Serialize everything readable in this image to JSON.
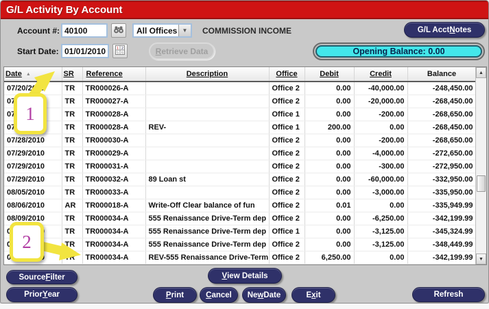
{
  "window": {
    "title": "G/L Activity By Account"
  },
  "toolbar": {
    "account_label": "Account #:",
    "account_value": "40100",
    "office_filter_value": "All Offices",
    "account_name": "COMMISSION INCOME",
    "start_date_label": "Start Date:",
    "start_date_value": "01/01/2010",
    "opening_balance": "Opening Balance: 0.00"
  },
  "buttons": {
    "gl_acct_notes": {
      "pre": "G/L Acct ",
      "mn": "N",
      "post": "otes"
    },
    "retrieve_data": {
      "pre": "",
      "mn": "R",
      "post": "etrieve Data"
    },
    "source_filter": {
      "pre": "Source ",
      "mn": "F",
      "post": "ilter"
    },
    "view_details": {
      "pre": "",
      "mn": "V",
      "post": "iew Details"
    },
    "prior_year": {
      "pre": "Prior ",
      "mn": "Y",
      "post": "ear"
    },
    "print": {
      "pre": "",
      "mn": "P",
      "post": "rint"
    },
    "cancel": {
      "pre": "",
      "mn": "C",
      "post": "ancel"
    },
    "new_date": {
      "pre": "Ne",
      "mn": "w",
      "post": " Date"
    },
    "exit": {
      "pre": "E",
      "mn": "x",
      "post": "it"
    },
    "refresh": {
      "pre": "Refresh",
      "mn": "",
      "post": ""
    }
  },
  "grid": {
    "columns": [
      "Date",
      "SR",
      "Reference",
      "Description",
      "Office",
      "Debit",
      "Credit",
      "Balance"
    ],
    "rows": [
      [
        "07/20/2010",
        "TR",
        "TR000026-A",
        "",
        "Office 2",
        "0.00",
        "-40,000.00",
        "-248,450.00"
      ],
      [
        "07/21/2010",
        "TR",
        "TR000027-A",
        "",
        "Office 2",
        "0.00",
        "-20,000.00",
        "-268,450.00"
      ],
      [
        "07/26/2010",
        "TR",
        "TR000028-A",
        "",
        "Office 1",
        "0.00",
        "-200.00",
        "-268,650.00"
      ],
      [
        "07/26/2010",
        "TR",
        "TR000028-A",
        "REV-",
        "Office 1",
        "200.00",
        "0.00",
        "-268,450.00"
      ],
      [
        "07/28/2010",
        "TR",
        "TR000030-A",
        "",
        "Office 2",
        "0.00",
        "-200.00",
        "-268,650.00"
      ],
      [
        "07/29/2010",
        "TR",
        "TR000029-A",
        "",
        "Office 2",
        "0.00",
        "-4,000.00",
        "-272,650.00"
      ],
      [
        "07/29/2010",
        "TR",
        "TR000031-A",
        "",
        "Office 2",
        "0.00",
        "-300.00",
        "-272,950.00"
      ],
      [
        "07/29/2010",
        "TR",
        "TR000032-A",
        "89 Loan st",
        "Office 2",
        "0.00",
        "-60,000.00",
        "-332,950.00"
      ],
      [
        "08/05/2010",
        "TR",
        "TR000033-A",
        "",
        "Office 2",
        "0.00",
        "-3,000.00",
        "-335,950.00"
      ],
      [
        "08/06/2010",
        "AR",
        "TR000018-A",
        "Write-Off Clear balance of fun",
        "Office 2",
        "0.01",
        "0.00",
        "-335,949.99"
      ],
      [
        "08/09/2010",
        "TR",
        "TR000034-A",
        "555 Renaissance Drive-Term dep",
        "Office 2",
        "0.00",
        "-6,250.00",
        "-342,199.99"
      ],
      [
        "08/09/2010",
        "TR",
        "TR000034-A",
        "555 Renaissance Drive-Term dep",
        "Office 1",
        "0.00",
        "-3,125.00",
        "-345,324.99"
      ],
      [
        "08/09/2010",
        "TR",
        "TR000034-A",
        "555 Renaissance Drive-Term dep",
        "Office 2",
        "0.00",
        "-3,125.00",
        "-348,449.99"
      ],
      [
        "08/09/2010",
        "TR",
        "TR000034-A",
        "REV-555 Renaissance Drive-Term",
        "Office 2",
        "6,250.00",
        "0.00",
        "-342,199.99"
      ]
    ]
  },
  "callouts": [
    {
      "label": "1"
    },
    {
      "label": "2"
    }
  ],
  "colors": {
    "title_bar_red": "#cf1313",
    "button_navy": "#2f3169",
    "opening_balance_cyan": "#43e6ea",
    "callout_yellow": "#f2e440",
    "callout_number_magenta": "#b23fa4"
  }
}
